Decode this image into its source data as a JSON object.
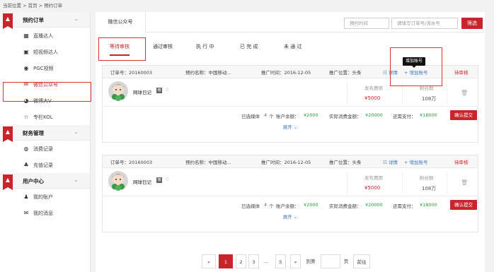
{
  "breadcrumb": "当前位置 > 首页 > 预约订单",
  "sidebar": {
    "sections": [
      {
        "title": "预约订单",
        "items": [
          {
            "label": "直播达人",
            "icon": "film-icon"
          },
          {
            "label": "短视频达人",
            "icon": "video-icon"
          },
          {
            "label": "PGC视频",
            "icon": "play-icon"
          },
          {
            "label": "微信公众号",
            "icon": "wechat-icon",
            "active": true
          },
          {
            "label": "微博大V",
            "icon": "weibo-icon"
          },
          {
            "label": "专栏KOL",
            "icon": "star-icon"
          }
        ]
      },
      {
        "title": "财务管理",
        "items": [
          {
            "label": "消费记录",
            "icon": "coin-icon"
          },
          {
            "label": "充值记录",
            "icon": "bag-icon"
          }
        ]
      },
      {
        "title": "用户中心",
        "items": [
          {
            "label": "我的账户",
            "icon": "user-icon"
          },
          {
            "label": "我的消息",
            "icon": "mail-icon"
          }
        ]
      }
    ]
  },
  "main": {
    "top_tab": "微信公众号",
    "date_placeholder": "预约时间",
    "order_placeholder": "请填写订单号/流水号",
    "filter_button": "筛选",
    "subtabs": [
      "等待审核",
      "通过审核",
      "执 行 中",
      "已 完 成",
      "未 通 过"
    ],
    "tooltip": "增加账号",
    "orders": [
      {
        "order_no": "订单号：20160003",
        "booking_name": "预约名称：中国移动...",
        "promo_time": "推广时间：2016-12-05",
        "promo_pos": "推广位置：头条",
        "detail_link": "☷ 详情",
        "add_account": "+ 增加账号",
        "status": "待审核",
        "media_name": "网球日记",
        "wx_badge": "微",
        "v_icon": "♢",
        "price_label": "发布费用",
        "price_value": "¥5000",
        "fans_label": "粉丝数",
        "fans_value": "108万",
        "selected_prefix": "已选媒体",
        "selected_count": "4",
        "selected_unit": "个",
        "balance_label": "账户余额：",
        "balance_value": "¥2000",
        "spend_label": "实际消费金额：",
        "spend_value": "¥20000",
        "due_label": "还需支付：",
        "due_value": "¥18000",
        "confirm_button": "确认提交",
        "expand_text": "展开 ⌄"
      },
      {
        "order_no": "订单号：20160003",
        "booking_name": "预约名称：中国移动...",
        "promo_time": "推广时间：2016-12-05",
        "promo_pos": "推广位置：头条",
        "detail_link": "☷ 详情",
        "add_account": "+ 增加账号",
        "status": "待审核",
        "media_name": "网球日记",
        "wx_badge": "微",
        "v_icon": "♢",
        "price_label": "发布费用",
        "price_value": "¥5000",
        "fans_label": "粉丝数",
        "fans_value": "108万",
        "selected_prefix": "已选媒体",
        "selected_count": "4",
        "selected_unit": "个",
        "balance_label": "账户余额：",
        "balance_value": "¥2000",
        "spend_label": "实际消费金额：",
        "spend_value": "¥20000",
        "due_label": "还需支付：",
        "due_value": "¥18000",
        "confirm_button": "确认提交",
        "expand_text": "展开 ⌄"
      }
    ]
  },
  "pagination": {
    "prev": "«",
    "pages": [
      "1",
      "2",
      "3",
      "...",
      "5"
    ],
    "next": "»",
    "goto_label": "到第",
    "page_unit": "页",
    "go_button": "前往",
    "current": "1"
  },
  "colors": {
    "accent": "#c9242b",
    "link": "#3a78c3",
    "money_green": "#2a9d3a"
  }
}
